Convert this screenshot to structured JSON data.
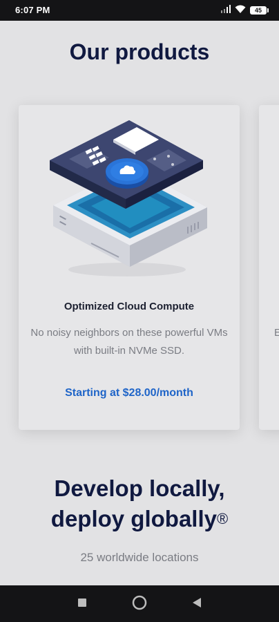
{
  "status_bar": {
    "time": "6:07 PM",
    "battery": "45",
    "icons": [
      "signal-icon",
      "wifi-icon",
      "battery-icon"
    ]
  },
  "products": {
    "title": "Our products",
    "cards": [
      {
        "title": "Optimized Cloud Compute",
        "description": "No noisy neighbors on these powerful VMs with built-in NVMe SSD.",
        "price": "Starting at $28.00/month",
        "illustration": "cloud-server-illustration"
      },
      {
        "peek_text": "E"
      }
    ]
  },
  "hero": {
    "heading_line1": "Develop locally,",
    "heading_line2": "deploy globally",
    "heading_mark": "®",
    "subtitle": "25 worldwide locations"
  },
  "nav_bar": {
    "buttons": [
      "recents-button",
      "home-button",
      "back-button"
    ]
  },
  "colors": {
    "background": "#e2e2e4",
    "heading": "#101940",
    "accent": "#1e64c8",
    "muted_text": "#7a7c83"
  }
}
